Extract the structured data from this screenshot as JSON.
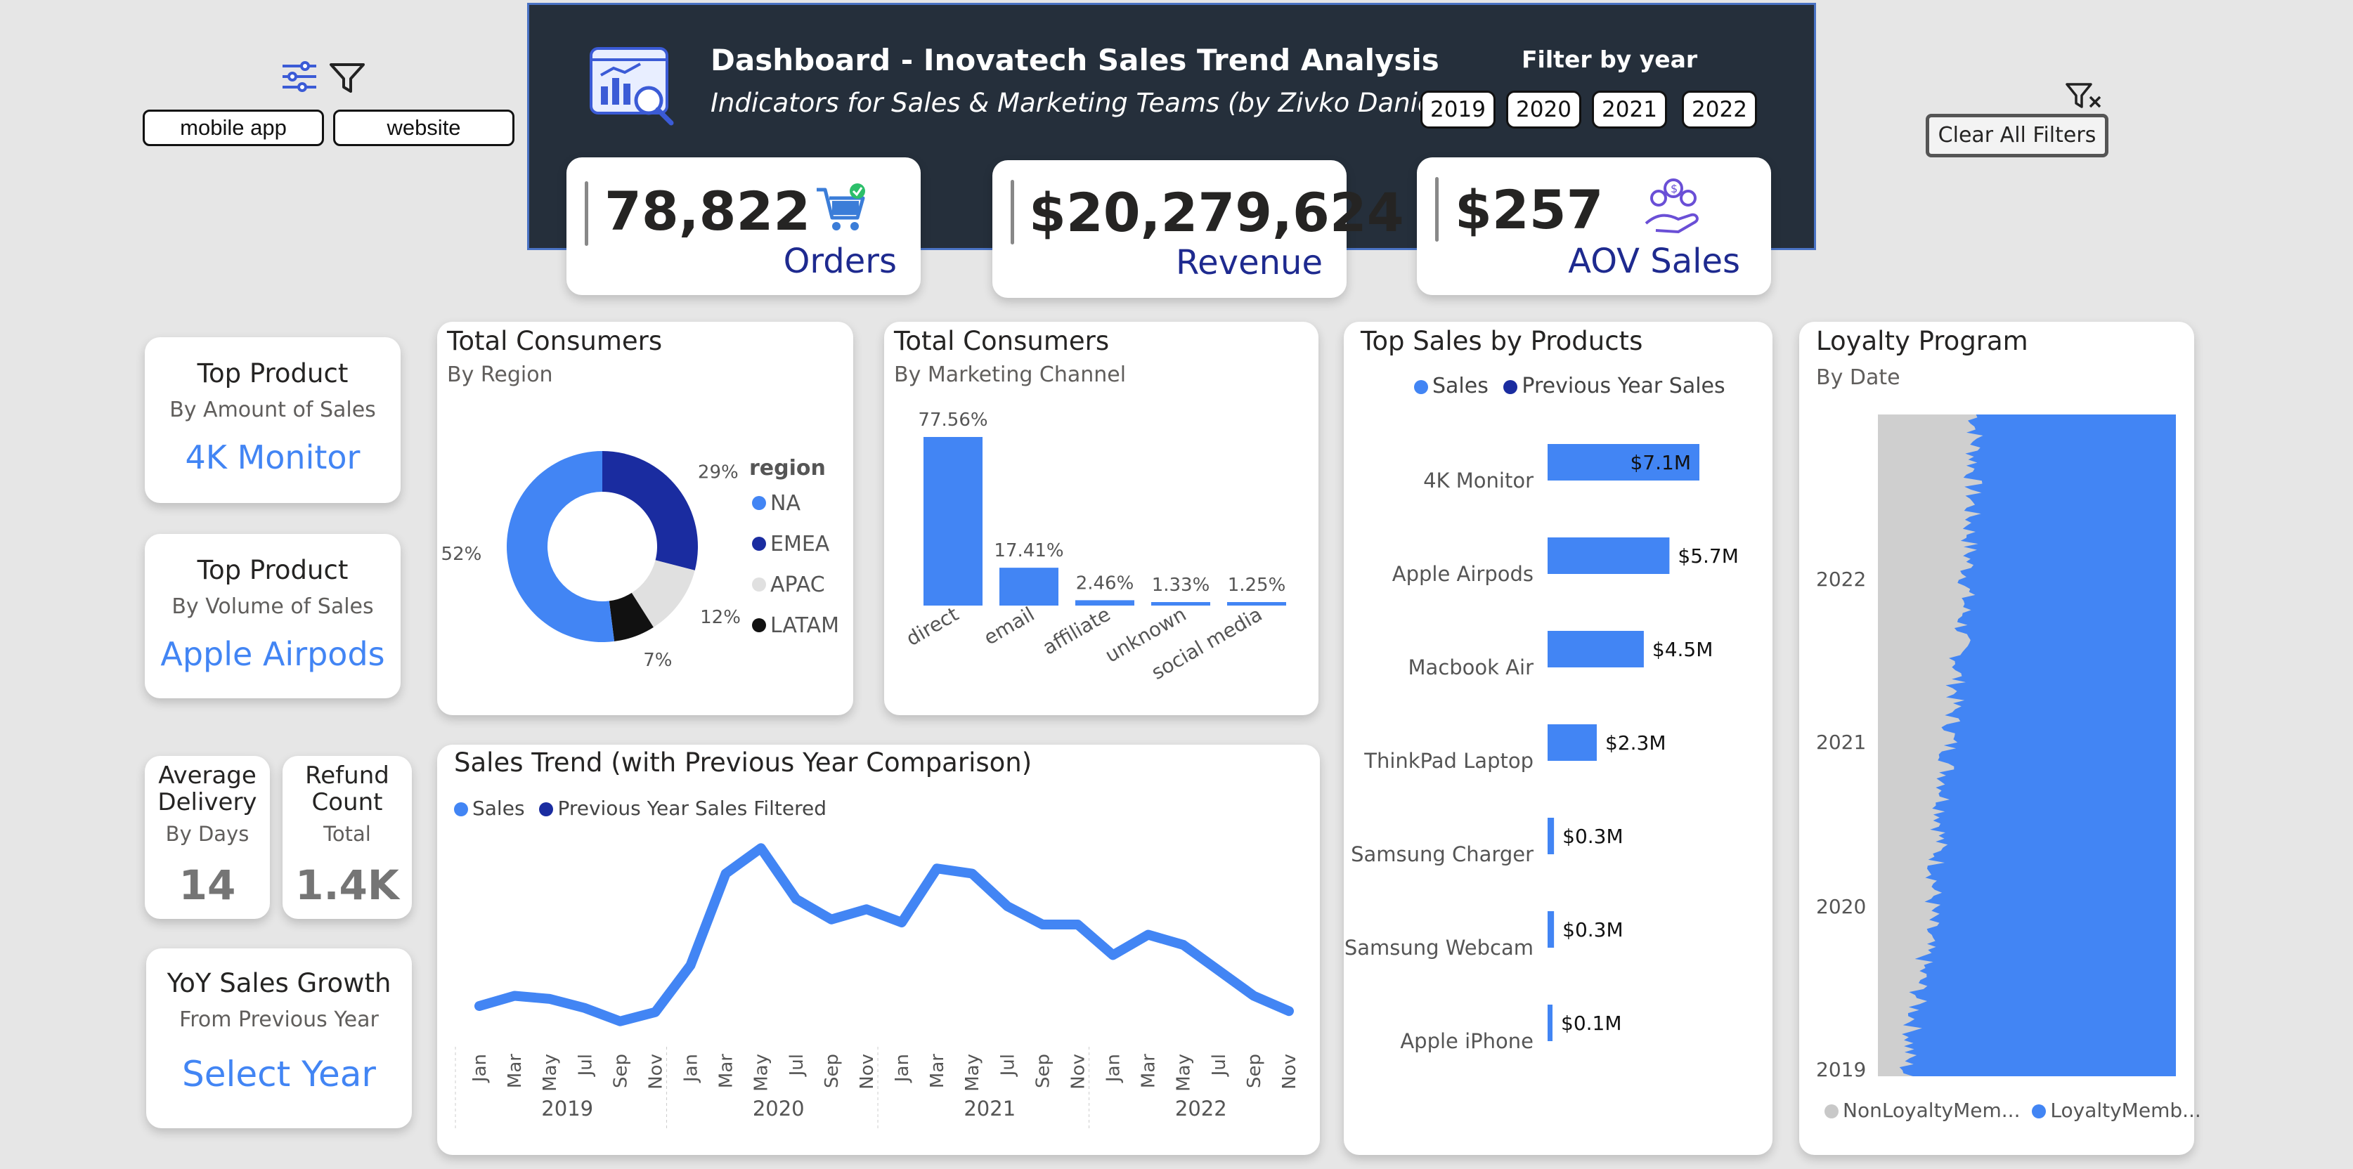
{
  "filters": {
    "icon_settings": "sliders-icon",
    "icon_filter": "filter-icon",
    "channels": [
      "mobile app",
      "website"
    ]
  },
  "header": {
    "title": "Dashboard - Inovatech Sales Trend Analysis",
    "subtitle": "Indicators for Sales & Marketing Teams (by Zivko Danicic)",
    "filter_label": "Filter by year",
    "years": [
      "2019",
      "2020",
      "2021",
      "2022"
    ]
  },
  "clear_filters": {
    "label": "Clear All Filters"
  },
  "kpis": {
    "orders": {
      "value": "78,822",
      "label": "Orders"
    },
    "revenue": {
      "value": "$20,279,624",
      "label": "Revenue"
    },
    "aov": {
      "value": "$257",
      "label": "AOV Sales"
    }
  },
  "side_cards": {
    "top_amount": {
      "title": "Top Product",
      "sub": "By Amount of Sales",
      "value": "4K Monitor"
    },
    "top_volume": {
      "title": "Top Product",
      "sub": "By Volume of Sales",
      "value": "Apple Airpods"
    },
    "delivery": {
      "title_1": "Average",
      "title_2": "Delivery",
      "sub": "By Days",
      "value": "14"
    },
    "refund": {
      "title_1": "Refund",
      "title_2": "Count",
      "sub": "Total",
      "value": "1.4K"
    },
    "yoy": {
      "title": "YoY Sales Growth",
      "sub": "From Previous Year",
      "value": "Select Year"
    }
  },
  "colors": {
    "primary": "#4285f4",
    "dark": "#1a2ca0",
    "grey": "#e0e0e0",
    "black": "#111111",
    "header_bg": "#252f3b"
  },
  "chart_data": [
    {
      "type": "pie",
      "title": "Total Consumers",
      "subtitle": "By Region",
      "legend_title": "region",
      "categories": [
        "NA",
        "EMEA",
        "APAC",
        "LATAM"
      ],
      "values": [
        52,
        29,
        12,
        7
      ],
      "labels": [
        "52%",
        "29%",
        "12%",
        "7%"
      ]
    },
    {
      "type": "bar",
      "title": "Total Consumers",
      "subtitle": "By Marketing Channel",
      "categories": [
        "direct",
        "email",
        "affiliate",
        "unknown",
        "social media"
      ],
      "values": [
        77.56,
        17.41,
        2.46,
        1.33,
        1.25
      ],
      "labels": [
        "77.56%",
        "17.41%",
        "2.46%",
        "1.33%",
        "1.25%"
      ]
    },
    {
      "type": "bar",
      "title": "Top Sales by Products",
      "legend": [
        "Sales",
        "Previous Year Sales"
      ],
      "categories": [
        "4K Monitor",
        "Apple Airpods",
        "Macbook Air",
        "ThinkPad Laptop",
        "Samsung Charger",
        "Samsung Webcam",
        "Apple iPhone"
      ],
      "values": [
        7.1,
        5.7,
        4.5,
        2.3,
        0.3,
        0.3,
        0.1
      ],
      "labels": [
        "$7.1M",
        "$5.7M",
        "$4.5M",
        "$2.3M",
        "$0.3M",
        "$0.3M",
        "$0.1M"
      ]
    },
    {
      "type": "line",
      "title": "Sales Trend (with Previous Year Comparison)",
      "legend": [
        "Sales",
        "Previous Year Sales Filtered"
      ],
      "month_labels": [
        "Jan",
        "Mar",
        "May",
        "Jul",
        "Sep",
        "Nov"
      ],
      "years": [
        "2019",
        "2020",
        "2021",
        "2022"
      ],
      "series": [
        {
          "name": "Sales",
          "values": [
            0.4,
            0.5,
            0.47,
            0.38,
            0.25,
            0.34,
            0.8,
            1.7,
            1.95,
            1.45,
            1.25,
            1.35,
            1.22,
            1.75,
            1.7,
            1.38,
            1.2,
            1.2,
            0.9,
            1.1,
            1.0,
            0.75,
            0.5,
            0.35
          ]
        }
      ]
    },
    {
      "type": "area",
      "title": "Loyalty Program",
      "subtitle": "By Date",
      "legend": [
        "NonLoyaltyMem...",
        "LoyaltyMemb..."
      ],
      "y_ticks": [
        "2022",
        "2021",
        "2020",
        "2019"
      ],
      "series": [
        {
          "name": "NonLoyaltyMem...",
          "values": [
            0.33,
            0.3,
            0.24,
            0.18,
            0.09
          ]
        },
        {
          "name": "LoyaltyMemb...",
          "values": [
            0.67,
            0.7,
            0.76,
            0.82,
            0.91
          ]
        }
      ]
    }
  ]
}
